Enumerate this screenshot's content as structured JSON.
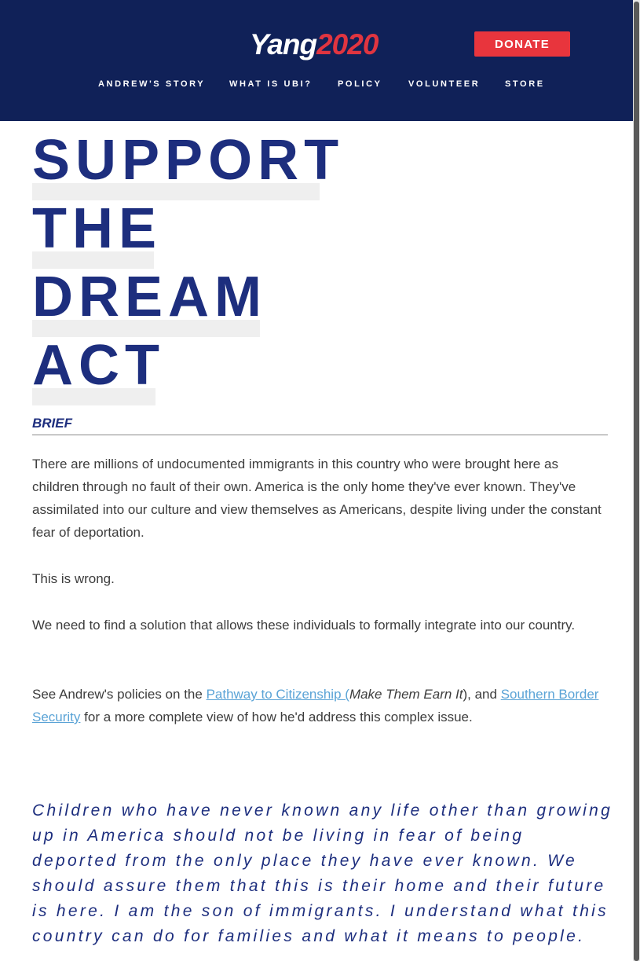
{
  "header": {
    "logo_name": "Yang",
    "logo_year": "2020",
    "donate_label": "DONATE",
    "nav": [
      {
        "label": "ANDREW'S STORY"
      },
      {
        "label": "WHAT IS UBI?"
      },
      {
        "label": "POLICY"
      },
      {
        "label": "VOLUNTEER"
      },
      {
        "label": "STORE"
      }
    ]
  },
  "colors": {
    "header_bg": "#102158",
    "accent_red": "#e8353d",
    "title_blue": "#1d2e7e",
    "link_blue": "#5aa3d6"
  },
  "main": {
    "title_lines": [
      "SUPPORT",
      "THE",
      "DREAM",
      "ACT"
    ],
    "section_label": "BRIEF",
    "paragraphs": [
      "There are millions of undocumented immigrants in this country who were brought here as children through no fault of their own. America is the only home they've ever known. They've assimilated into our culture and view themselves as Americans, despite living under the constant fear of deportation.",
      "This is wrong.",
      "We need to find a solution that allows these individuals to formally integrate into our country."
    ],
    "policy_links": {
      "prefix": "See Andrew's policies on the ",
      "link1": "Pathway to Citizenship (",
      "link1_italic": "Make Them Earn It",
      "middle": "), and ",
      "link2": "Southern Border Security",
      "suffix": " for a more complete view of how he'd address this complex issue."
    },
    "quote": "Children who have never known any life other than growing up in America should not be living in fear of being deported from the only place they have ever known.  We should assure them that this is their home and their future is here. I am the son of immigrants. I understand what this country can do for families and what it means to people."
  }
}
